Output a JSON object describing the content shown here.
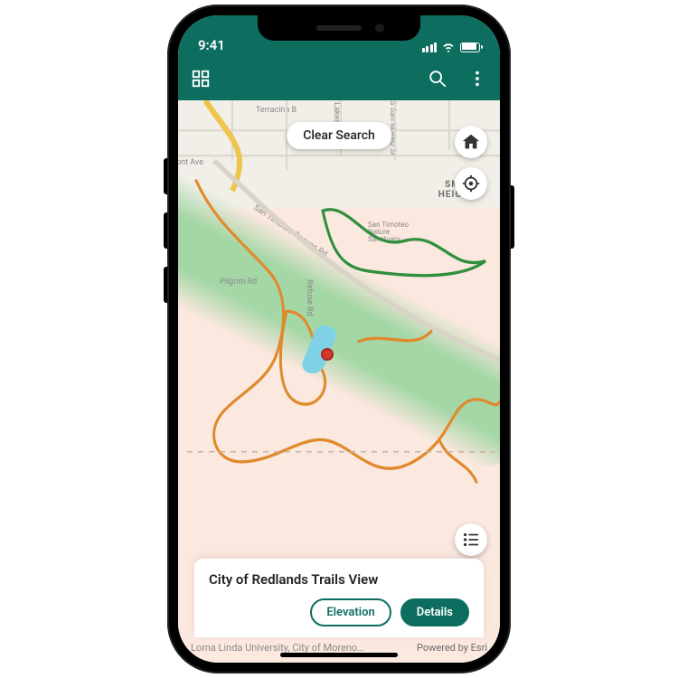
{
  "status": {
    "time": "9:41"
  },
  "appbar": {
    "clear_label": "Clear Search"
  },
  "map": {
    "labels": {
      "terracina": "Terracina B",
      "lakeside": "Lakeside Ave",
      "sanmateo": "S San Mateo St",
      "ontave": "ont Ave",
      "canyon": "San Timoteo Canyon Rd",
      "pilgrim": "Pilgrim Rd",
      "refuse": "Refuse Rd",
      "sanctuary": "San Timoteo Nature Sanctuary"
    },
    "neighborhood": "SMILE HEIGHTS"
  },
  "card": {
    "title": "City of Redlands Trails View",
    "elevation_label": "Elevation",
    "details_label": "Details"
  },
  "attribution": {
    "left": "Loma Linda University, City of Moreno…",
    "right": "Powered by Esri"
  }
}
